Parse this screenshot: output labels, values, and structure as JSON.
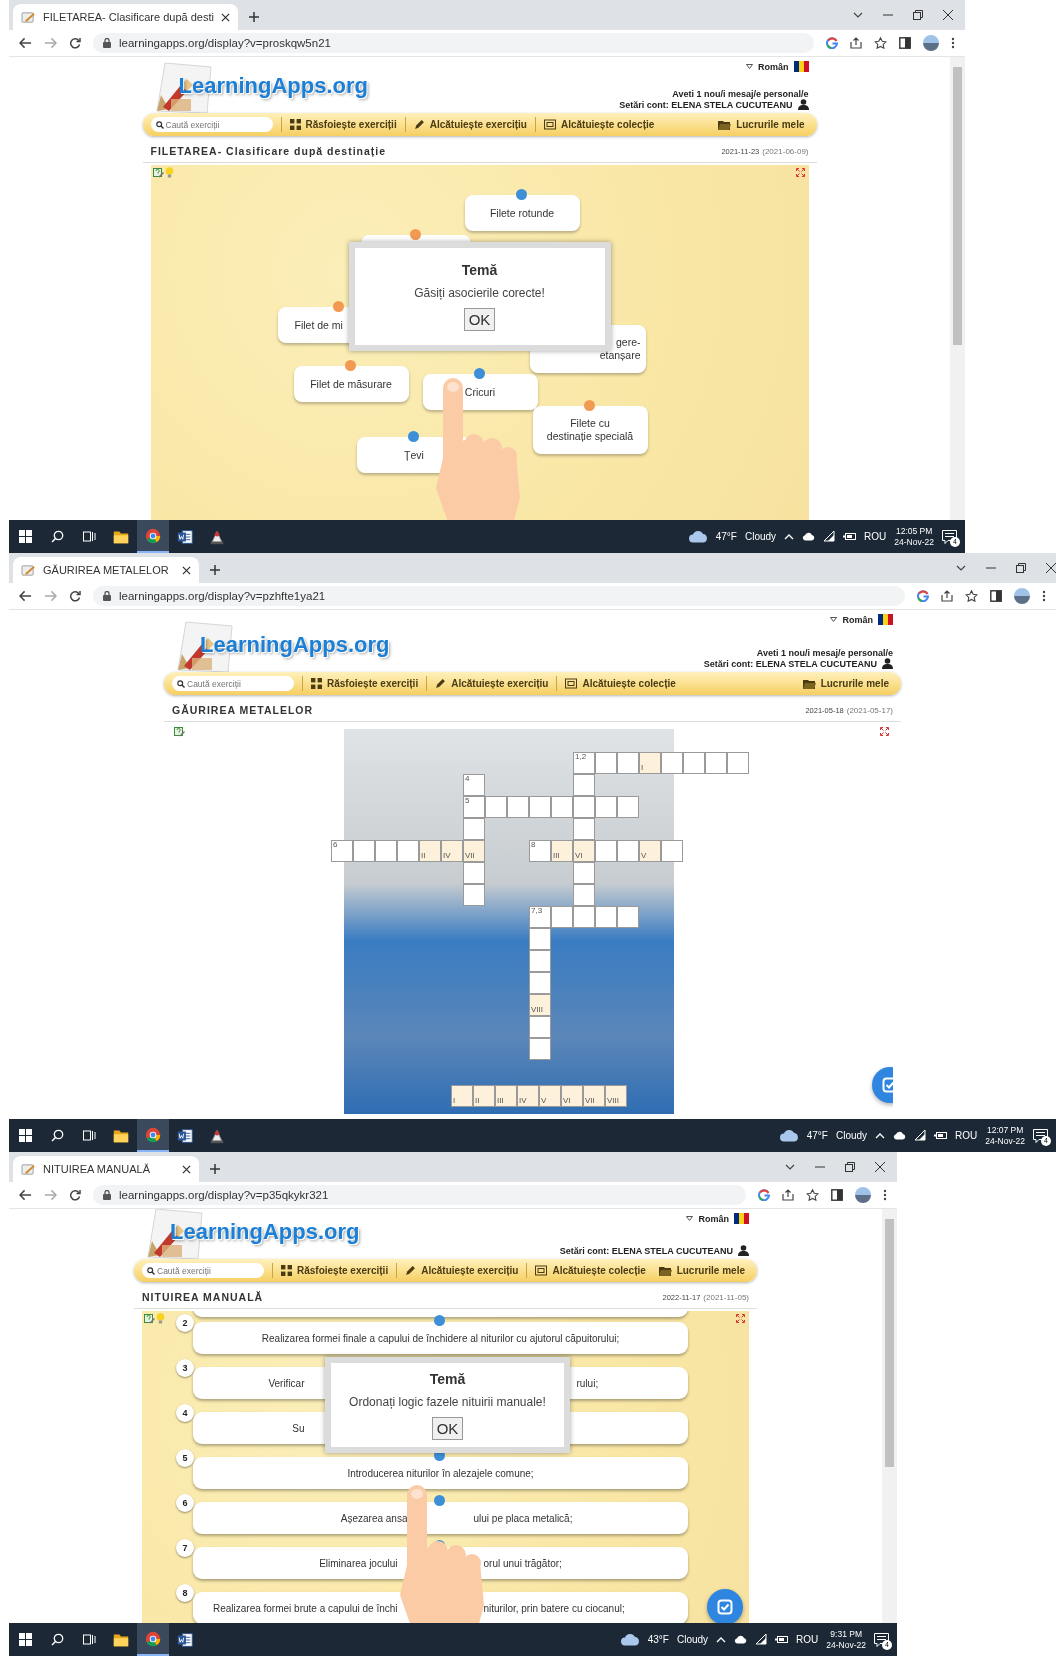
{
  "screens": [
    {
      "kind": "matching",
      "tab": {
        "title": "FILETAREA- Clasificare după desti"
      },
      "url": "learningapps.org/display?v=proskqw5n21",
      "site": {
        "logo": "LearningApps.org",
        "language": "Român",
        "notice": "Aveti **1** nou/i mesaj/e personal/e",
        "account": "Setări cont: ELENA STELA CUCUTEANU",
        "search_placeholder": "Caută exerciții",
        "nav": [
          "Răsfoiește exerciții",
          "Alcătuiește exercițiu",
          "Alcătuiește colecție",
          "Lucrurile mele"
        ]
      },
      "exercise": {
        "title": "FILETAREA- Clasificare după destinație",
        "date": "2021-11-23",
        "date_created": "(2021-06-09)",
        "hint_bulb": true
      },
      "cards": [
        {
          "label": "Filete rotunde",
          "color": "#3d8fd8"
        },
        {
          "color": "#f39a52"
        },
        {
          "label": "Filet de mi",
          "color": "#f39a52"
        },
        {
          "label": "gere-\netanșare"
        },
        {
          "label": "Filet de măsurare",
          "color": "#f39a52"
        },
        {
          "label": "Cricuri",
          "color": "#3d8fd8"
        },
        {
          "label": "Filete cu\ndestinație specială",
          "color": "#f39a52"
        },
        {
          "label": "Țevi",
          "color": "#3d8fd8"
        }
      ],
      "dialog": {
        "title": "Temă",
        "message": "Găsiți asocierile corecte!",
        "button": "OK"
      },
      "taskbar": {
        "apps": [
          {
            "kind": "explorer",
            "selected": false
          },
          {
            "kind": "chrome",
            "selected": true
          },
          {
            "kind": "word",
            "selected": false
          },
          {
            "kind": "tool",
            "selected": false
          }
        ],
        "temperature": "47°F",
        "weather": "Cloudy",
        "language": "ROU",
        "time": "12:05 PM",
        "date": "24-Nov-22",
        "notifications": "4"
      }
    },
    {
      "kind": "crossword",
      "tab": {
        "title": "GĂURIREA METALELOR"
      },
      "url": "learningapps.org/display?v=pzhfte1ya21",
      "site": {
        "logo": "LearningApps.org",
        "language": "Român",
        "notice": "Aveti **1** nou/i mesaj/e personal/e",
        "account": "Setări cont: ELENA STELA CUCUTEANU",
        "search_placeholder": "Caută exerciții",
        "nav": [
          "Răsfoiește exerciții",
          "Alcătuiește exercițiu",
          "Alcătuiește colecție",
          "Lucrurile mele"
        ]
      },
      "exercise": {
        "title": "GĂURIREA METALELOR",
        "date": "2021-05-18",
        "date_created": "(2021-05-17)",
        "hint_bulb": false
      },
      "crossword": {
        "rows": [
          {
            "cells": [
              {
                "kind": "gap"
              },
              {
                "kind": "gap"
              },
              {
                "kind": "gap"
              },
              {
                "kind": "gap"
              },
              {
                "kind": "gap"
              },
              {
                "kind": "gap"
              },
              {
                "kind": "gap"
              },
              {
                "kind": "gap"
              },
              {
                "kind": "gap"
              },
              {
                "kind": "gap"
              },
              {
                "kind": "gap"
              },
              {
                "kind": "cell",
                "label": "1,2"
              },
              {
                "kind": "cell"
              },
              {
                "kind": "cell"
              },
              {
                "kind": "key",
                "label": "I"
              },
              {
                "kind": "cell"
              },
              {
                "kind": "cell"
              },
              {
                "kind": "cell"
              },
              {
                "kind": "cell"
              }
            ]
          },
          {
            "cells": [
              {
                "kind": "gap"
              },
              {
                "kind": "gap"
              },
              {
                "kind": "gap"
              },
              {
                "kind": "gap"
              },
              {
                "kind": "gap"
              },
              {
                "kind": "gap"
              },
              {
                "kind": "cell",
                "label": "4"
              },
              {
                "kind": "gap"
              },
              {
                "kind": "gap"
              },
              {
                "kind": "gap"
              },
              {
                "kind": "gap"
              },
              {
                "kind": "cell"
              }
            ]
          },
          {
            "cells": [
              {
                "kind": "gap"
              },
              {
                "kind": "gap"
              },
              {
                "kind": "gap"
              },
              {
                "kind": "gap"
              },
              {
                "kind": "gap"
              },
              {
                "kind": "gap"
              },
              {
                "kind": "cell",
                "label": "5"
              },
              {
                "kind": "cell"
              },
              {
                "kind": "cell"
              },
              {
                "kind": "cell"
              },
              {
                "kind": "cell"
              },
              {
                "kind": "cell"
              },
              {
                "kind": "cell"
              },
              {
                "kind": "cell"
              }
            ]
          },
          {
            "cells": [
              {
                "kind": "gap"
              },
              {
                "kind": "gap"
              },
              {
                "kind": "gap"
              },
              {
                "kind": "gap"
              },
              {
                "kind": "gap"
              },
              {
                "kind": "gap"
              },
              {
                "kind": "cell"
              },
              {
                "kind": "gap"
              },
              {
                "kind": "gap"
              },
              {
                "kind": "gap"
              },
              {
                "kind": "gap"
              },
              {
                "kind": "cell"
              }
            ]
          },
          {
            "cells": [
              {
                "kind": "cell",
                "label": "6"
              },
              {
                "kind": "cell"
              },
              {
                "kind": "cell"
              },
              {
                "kind": "cell"
              },
              {
                "kind": "key",
                "label": "II"
              },
              {
                "kind": "key",
                "label": "IV"
              },
              {
                "kind": "key",
                "label": "VII"
              },
              {
                "kind": "gap"
              },
              {
                "kind": "gap"
              },
              {
                "kind": "cell",
                "label": "8"
              },
              {
                "kind": "key",
                "label": "III"
              },
              {
                "kind": "key",
                "label": "VI"
              },
              {
                "kind": "cell"
              },
              {
                "kind": "cell"
              },
              {
                "kind": "key",
                "label": "V"
              },
              {
                "kind": "cell"
              }
            ]
          },
          {
            "cells": [
              {
                "kind": "gap"
              },
              {
                "kind": "gap"
              },
              {
                "kind": "gap"
              },
              {
                "kind": "gap"
              },
              {
                "kind": "gap"
              },
              {
                "kind": "gap"
              },
              {
                "kind": "cell"
              },
              {
                "kind": "gap"
              },
              {
                "kind": "gap"
              },
              {
                "kind": "gap"
              },
              {
                "kind": "gap"
              },
              {
                "kind": "cell"
              }
            ]
          },
          {
            "cells": [
              {
                "kind": "gap"
              },
              {
                "kind": "gap"
              },
              {
                "kind": "gap"
              },
              {
                "kind": "gap"
              },
              {
                "kind": "gap"
              },
              {
                "kind": "gap"
              },
              {
                "kind": "cell"
              },
              {
                "kind": "gap"
              },
              {
                "kind": "gap"
              },
              {
                "kind": "gap"
              },
              {
                "kind": "gap"
              },
              {
                "kind": "cell"
              }
            ]
          },
          {
            "cells": [
              {
                "kind": "gap"
              },
              {
                "kind": "gap"
              },
              {
                "kind": "gap"
              },
              {
                "kind": "gap"
              },
              {
                "kind": "gap"
              },
              {
                "kind": "gap"
              },
              {
                "kind": "gap"
              },
              {
                "kind": "gap"
              },
              {
                "kind": "gap"
              },
              {
                "kind": "cell",
                "label": "7,3"
              },
              {
                "kind": "cell"
              },
              {
                "kind": "cell"
              },
              {
                "kind": "cell"
              },
              {
                "kind": "cell"
              }
            ]
          },
          {
            "cells": [
              {
                "kind": "gap"
              },
              {
                "kind": "gap"
              },
              {
                "kind": "gap"
              },
              {
                "kind": "gap"
              },
              {
                "kind": "gap"
              },
              {
                "kind": "gap"
              },
              {
                "kind": "gap"
              },
              {
                "kind": "gap"
              },
              {
                "kind": "gap"
              },
              {
                "kind": "cell"
              }
            ]
          },
          {
            "cells": [
              {
                "kind": "gap"
              },
              {
                "kind": "gap"
              },
              {
                "kind": "gap"
              },
              {
                "kind": "gap"
              },
              {
                "kind": "gap"
              },
              {
                "kind": "gap"
              },
              {
                "kind": "gap"
              },
              {
                "kind": "gap"
              },
              {
                "kind": "gap"
              },
              {
                "kind": "cell"
              }
            ]
          },
          {
            "cells": [
              {
                "kind": "gap"
              },
              {
                "kind": "gap"
              },
              {
                "kind": "gap"
              },
              {
                "kind": "gap"
              },
              {
                "kind": "gap"
              },
              {
                "kind": "gap"
              },
              {
                "kind": "gap"
              },
              {
                "kind": "gap"
              },
              {
                "kind": "gap"
              },
              {
                "kind": "cell"
              }
            ]
          },
          {
            "cells": [
              {
                "kind": "gap"
              },
              {
                "kind": "gap"
              },
              {
                "kind": "gap"
              },
              {
                "kind": "gap"
              },
              {
                "kind": "gap"
              },
              {
                "kind": "gap"
              },
              {
                "kind": "gap"
              },
              {
                "kind": "gap"
              },
              {
                "kind": "gap"
              },
              {
                "kind": "key",
                "label": "VIII"
              }
            ]
          },
          {
            "cells": [
              {
                "kind": "gap"
              },
              {
                "kind": "gap"
              },
              {
                "kind": "gap"
              },
              {
                "kind": "gap"
              },
              {
                "kind": "gap"
              },
              {
                "kind": "gap"
              },
              {
                "kind": "gap"
              },
              {
                "kind": "gap"
              },
              {
                "kind": "gap"
              },
              {
                "kind": "cell"
              }
            ]
          },
          {
            "cells": [
              {
                "kind": "gap"
              },
              {
                "kind": "gap"
              },
              {
                "kind": "gap"
              },
              {
                "kind": "gap"
              },
              {
                "kind": "gap"
              },
              {
                "kind": "gap"
              },
              {
                "kind": "gap"
              },
              {
                "kind": "gap"
              },
              {
                "kind": "gap"
              },
              {
                "kind": "cell"
              }
            ]
          }
        ],
        "key": [
          "I",
          "II",
          "III",
          "IV",
          "V",
          "VI",
          "VII",
          "VIII"
        ]
      },
      "taskbar": {
        "apps": [
          {
            "kind": "explorer",
            "selected": false
          },
          {
            "kind": "chrome",
            "selected": true
          },
          {
            "kind": "word",
            "selected": false
          },
          {
            "kind": "tool",
            "selected": false
          }
        ],
        "temperature": "47°F",
        "weather": "Cloudy",
        "language": "ROU",
        "time": "12:07 PM",
        "date": "24-Nov-22",
        "notifications": "4"
      }
    },
    {
      "kind": "ordering",
      "tab": {
        "title": "NITUIREA MANUALĂ"
      },
      "url": "learningapps.org/display?v=p35qkykr321",
      "site": {
        "logo": "LearningApps.org",
        "language": "Român",
        "account": "Setări cont: ELENA STELA CUCUTEANU",
        "search_placeholder": "Caută exerciții",
        "nav": [
          "Răsfoiește exerciții",
          "Alcătuiește exercițiu",
          "Alcătuiește colecție",
          "Lucrurile mele"
        ]
      },
      "exercise": {
        "title": "NITUIREA MANUALĂ",
        "date": "2022-11-17",
        "date_created": "(2021-11-05)",
        "hint_bulb": true
      },
      "items": [
        {
          "number": "2",
          "parts": [
            "Realizarea formei finale a capului de închidere al niturilor cu ajutorul căpuitorului;"
          ]
        },
        {
          "number": "3",
          "parts": [
            "Verificar",
            "rului;"
          ]
        },
        {
          "number": "4",
          "parts": [
            "Su"
          ]
        },
        {
          "number": "5",
          "parts": [
            "Introducerea niturilor în alezajele comune;"
          ]
        },
        {
          "number": "6",
          "parts": [
            "Așezarea ansa",
            "ului pe placa metalică;"
          ]
        },
        {
          "number": "7",
          "parts": [
            "Eliminarea jocului",
            "orul unui trăgător;"
          ]
        },
        {
          "number": "8",
          "parts": [
            "Realizarea formei brute a capului de închi",
            "niturilor, prin batere cu ciocanul;"
          ]
        }
      ],
      "dialog": {
        "title": "Temă",
        "message": "Ordonați logic fazele nituirii manuale!",
        "button": "OK"
      },
      "taskbar": {
        "apps": [
          {
            "kind": "explorer",
            "selected": false
          },
          {
            "kind": "chrome",
            "selected": true
          },
          {
            "kind": "word",
            "selected": false
          }
        ],
        "temperature": "43°F",
        "weather": "Cloudy",
        "language": "ROU",
        "time": "9:31 PM",
        "date": "24-Nov-22",
        "notifications": "4"
      }
    }
  ]
}
